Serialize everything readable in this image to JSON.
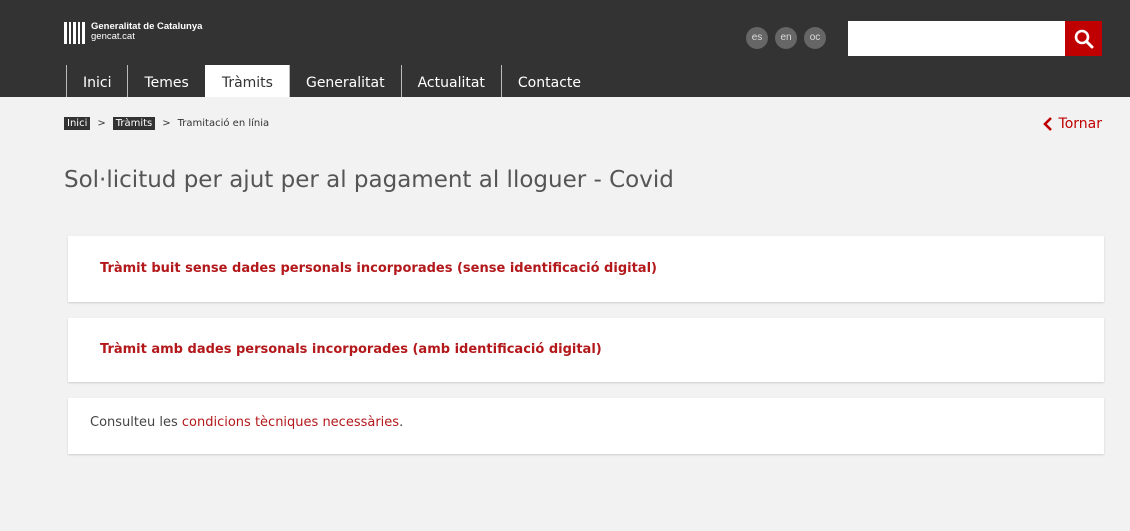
{
  "header": {
    "logo_title": "Generalitat de Catalunya",
    "logo_subtitle": "gencat.cat",
    "languages": [
      "es",
      "en",
      "oc"
    ],
    "search": {
      "value": "",
      "placeholder": ""
    },
    "colors": {
      "bar": "#333333",
      "accent": "#c00000"
    }
  },
  "nav": {
    "items": [
      "Inici",
      "Temes",
      "Tràmits",
      "Generalitat",
      "Actualitat",
      "Contacte"
    ],
    "active": "Tràmits"
  },
  "breadcrumb": {
    "items": [
      "Inici",
      "Tràmits",
      "Tramitació en línia"
    ],
    "separator": ">"
  },
  "back_label": "Tornar",
  "page_title": "Sol·licitud per ajut per al pagament al lloguer - Covid",
  "options": [
    {
      "label": "Tràmit buit sense dades personals incorporades (sense identificació digital)"
    },
    {
      "label": "Tràmit amb dades personals incorporades (amb identificació digital)"
    }
  ],
  "info": {
    "prefix": "Consulteu les ",
    "link": "condicions tècniques necessàries",
    "suffix": "."
  }
}
